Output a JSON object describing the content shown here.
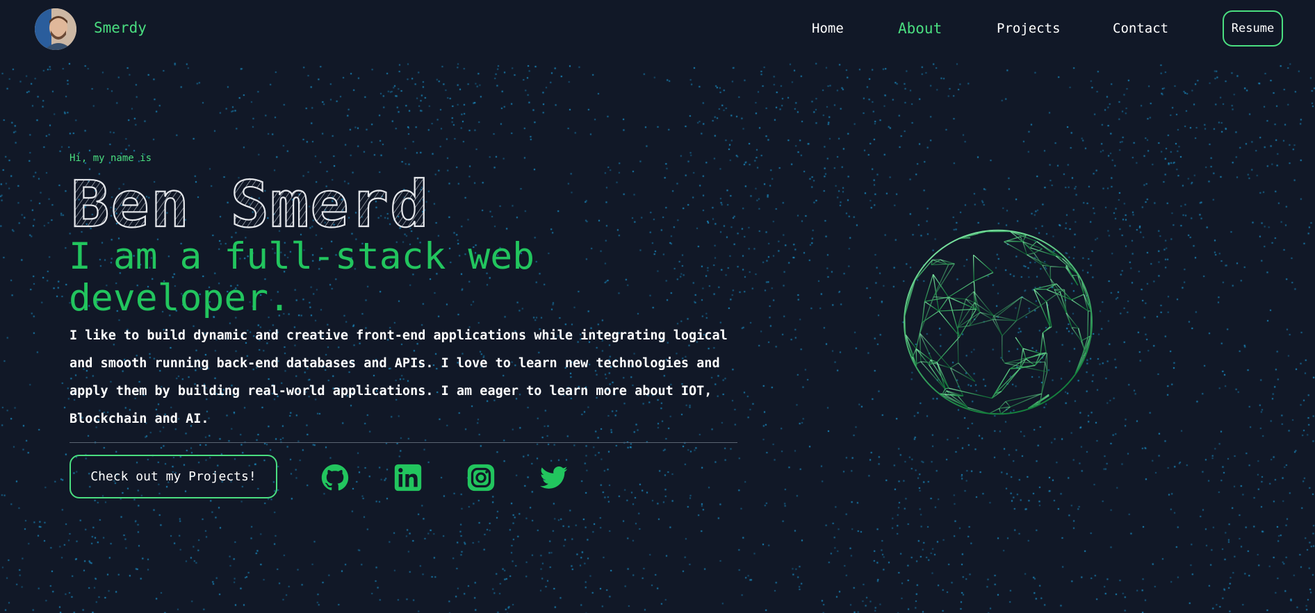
{
  "header": {
    "brand": "Smerdy",
    "nav": [
      {
        "label": "Home",
        "active": false
      },
      {
        "label": "About",
        "active": true
      },
      {
        "label": "Projects",
        "active": false
      },
      {
        "label": "Contact",
        "active": false
      }
    ],
    "resume_label": "Resume"
  },
  "hero": {
    "greeting": "Hi, my name is",
    "name": "Ben Smerd",
    "tagline": "I am a full-stack web developer.",
    "bio": "I like to build dynamic and creative front-end applications while integrating logical and smooth running back-end databases and APIs. I love to learn new technologies and apply them by building real-world applications. I am eager to learn more about IOT, Blockchain and AI.",
    "cta_label": "Check out my Projects!"
  },
  "social": [
    {
      "icon": "github-icon"
    },
    {
      "icon": "linkedin-icon"
    },
    {
      "icon": "instagram-icon"
    },
    {
      "icon": "twitter-icon"
    }
  ],
  "colors": {
    "background": "#111827",
    "accent": "#4ade80",
    "accent_dark": "#22c55e",
    "dots": "#1d9bd6"
  }
}
